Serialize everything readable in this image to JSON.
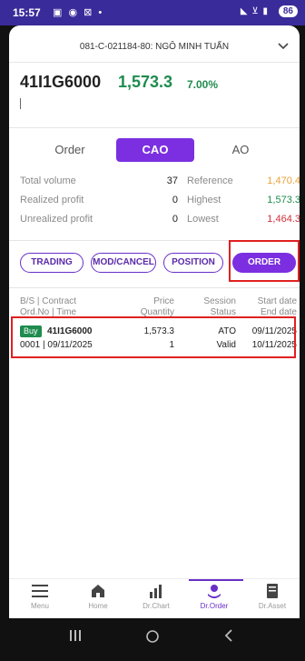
{
  "status_bar": {
    "time": "15:57",
    "left_icons": "▣ ◉ ⊠ •",
    "right_icons": "◣ ⊻ ▮",
    "battery": "86"
  },
  "account": {
    "text": "081-C-021184-80: NGÔ MINH TUẤN"
  },
  "quote": {
    "symbol": "41I1G6000",
    "price": "1,573.3",
    "change_pct": "7.00%"
  },
  "order_tabs": [
    "Order",
    "CAO",
    "AO"
  ],
  "stats": [
    {
      "label": "Total volume",
      "value": "37",
      "label2": "Reference",
      "value2": "1,470.4",
      "color2": "#e8a23a"
    },
    {
      "label": "Realized profit",
      "value": "0",
      "label2": "Highest",
      "value2": "1,573.3",
      "color2": "#1e8c4e"
    },
    {
      "label": "Unrealized profit",
      "value": "0",
      "label2": "Lowest",
      "value2": "1,464.3",
      "color2": "#d0303a"
    }
  ],
  "actions": [
    "TRADING",
    "MOD/CANCEL",
    "POSITION",
    "ORDER BOOK"
  ],
  "table": {
    "headers": [
      [
        "B/S | Contract",
        "Ord.No | Time"
      ],
      [
        "Price",
        "Quantity"
      ],
      [
        "Session",
        "Status"
      ],
      [
        "Start date",
        "End date"
      ]
    ],
    "rows": [
      {
        "side": "Buy",
        "contract": "41I1G6000",
        "ordno_time": "0001 | 09/11/2025",
        "price": "1,573.3",
        "quantity": "1",
        "session": "ATO",
        "status": "Valid",
        "start_date": "09/11/2025",
        "end_date": "10/11/2025"
      }
    ]
  },
  "bottom_nav": [
    "Menu",
    "Home",
    "Dr.Chart",
    "Dr.Order",
    "Dr.Asset"
  ],
  "colors": {
    "accent": "#7b2fe0",
    "up": "#1e8c4e",
    "down": "#d0303a",
    "reference": "#e8a23a",
    "highlight": "#e02020"
  }
}
